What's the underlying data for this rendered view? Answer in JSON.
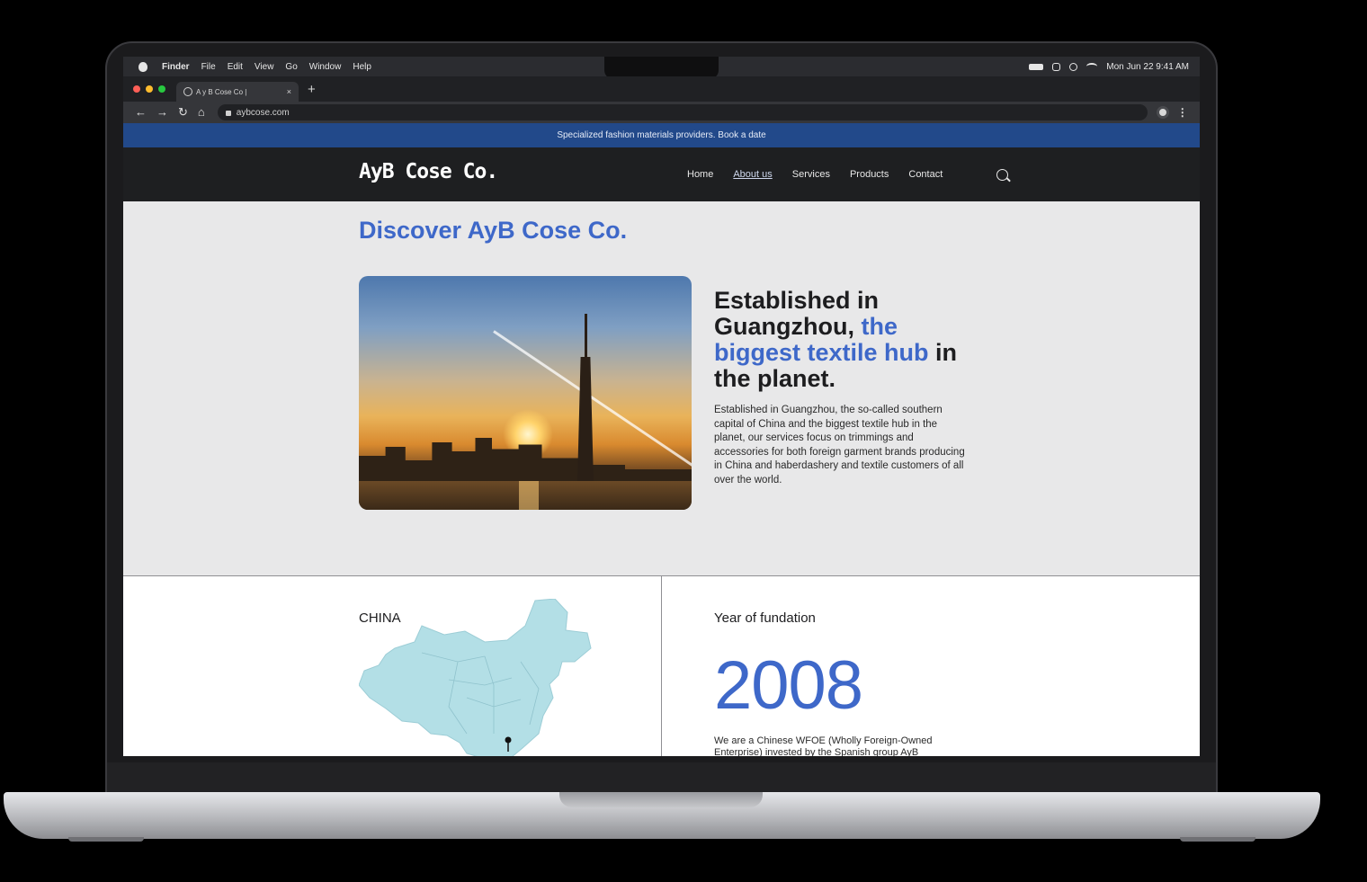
{
  "menubar": {
    "app": "Finder",
    "items": [
      "Finder",
      "File",
      "Edit",
      "View",
      "Go",
      "Window",
      "Help"
    ],
    "datetime": "Mon Jun 22  9:41 AM"
  },
  "browser": {
    "tab_title": "A y B Cose Co |",
    "tab_close": "×",
    "new_tab": "+",
    "url": "aybcose.com",
    "nav_icons": [
      "back-arrow-icon",
      "forward-arrow-icon",
      "reload-icon",
      "home-icon"
    ]
  },
  "site": {
    "promo": "Specialized fashion materials providers. Book a date",
    "logo": "AyB Cose Co.",
    "nav": [
      "Home",
      "About us",
      "Services",
      "Products",
      "Contact"
    ],
    "active_nav": "About us",
    "page_title": "Discover AyB Cose Co.",
    "headline_part1": "Established in Guangzhou, ",
    "headline_highlight": "the biggest textile hub",
    "headline_part2": " in the planet.",
    "body": "Established in Guangzhou, the so-called southern capital of China and the biggest textile hub in the planet, our services focus on trimmings and accessories for both foreign garment brands producing in China and haberdashery and textile customers of all over the world.",
    "map_label": "CHINA",
    "year_label": "Year of fundation",
    "year_value": "2008",
    "year_desc": "We are a Chinese WFOE (Wholly Foreign-Owned Enterprise) invested by the Spanish group AyB"
  },
  "colors": {
    "accent": "#3e68c9",
    "promo_bar": "#22498a",
    "nav_bg": "#1e1f21",
    "map_fill": "#b3dfe6"
  }
}
